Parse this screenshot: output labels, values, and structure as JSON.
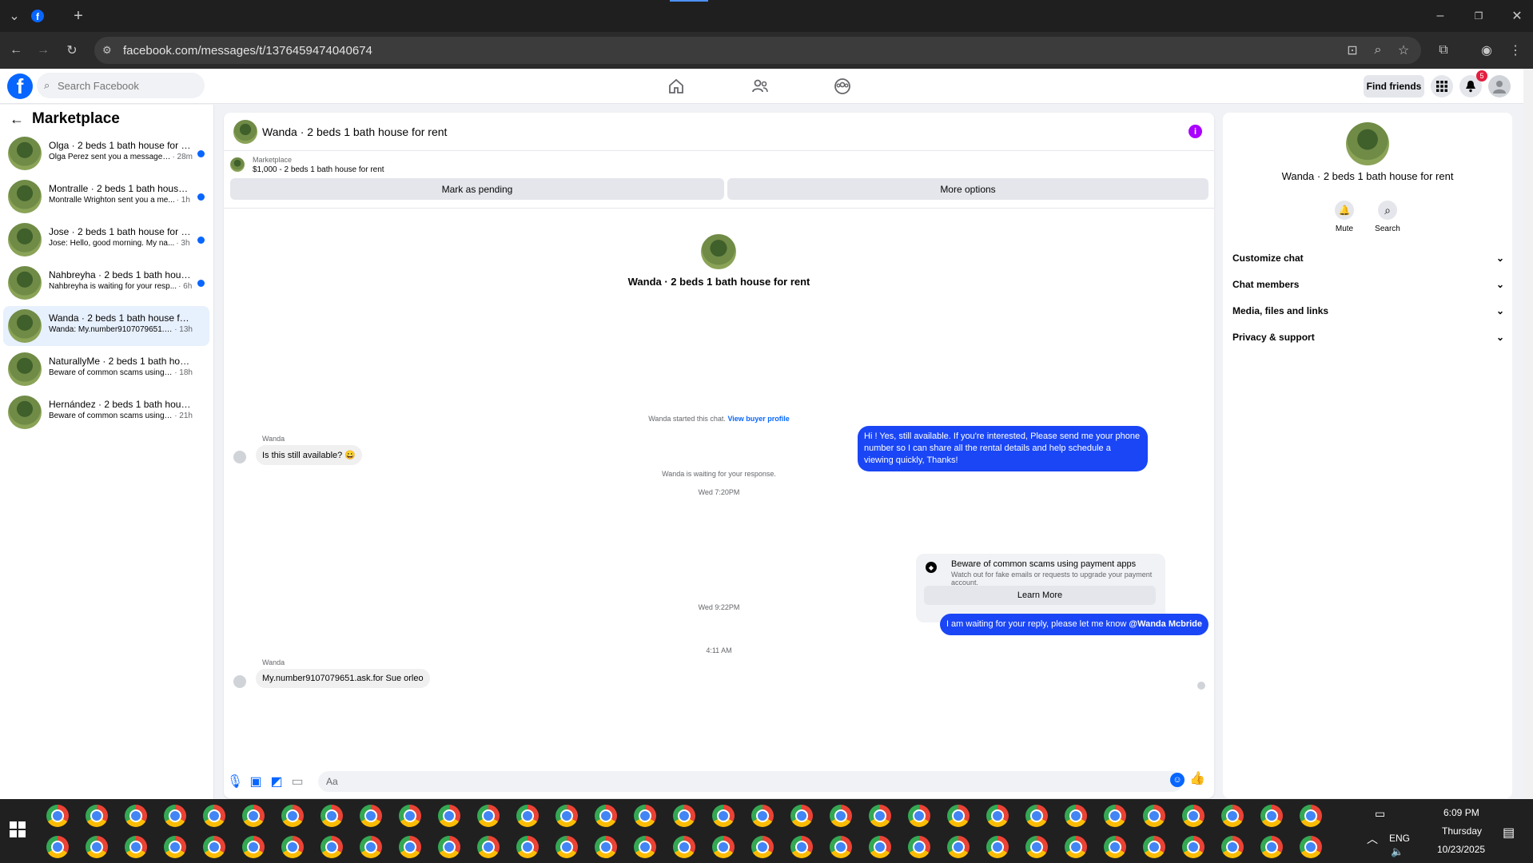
{
  "browser": {
    "url": "facebook.com/messages/t/1376459474040674",
    "tab_icon": "facebook-icon"
  },
  "header": {
    "search_placeholder": "Search Facebook",
    "find_friends": "Find friends",
    "notif_count": "5"
  },
  "sidebar": {
    "title": "Marketplace",
    "conversations": [
      {
        "title": "Olga · 2 beds 1 bath house for rent",
        "preview": "Olga Perez sent you a message a...",
        "time": "· 28m",
        "unread": true
      },
      {
        "title": "Montralle · 2 beds 1 bath house f...",
        "preview": "Montralle Wrighton sent you a me...",
        "time": "· 1h",
        "unread": true
      },
      {
        "title": "Jose · 2 beds 1 bath house for rent",
        "preview": "Jose: Hello, good morning. My na...",
        "time": "· 3h",
        "unread": true
      },
      {
        "title": "Nahbreyha · 2 beds 1 bath house...",
        "preview": "Nahbreyha is waiting for your resp...",
        "time": "· 6h",
        "unread": true
      },
      {
        "title": "Wanda · 2 beds 1 bath house for re...",
        "preview": "Wanda: My.number9107079651.ask.f...",
        "time": "· 13h",
        "unread": false
      },
      {
        "title": "NaturallyMe · 2 beds 1 bath house ...",
        "preview": "Beware of common scams using pay...",
        "time": "· 18h",
        "unread": false
      },
      {
        "title": "Hernández · 2 beds 1 bath hous...",
        "preview": "Beware of common scams using ...",
        "time": "· 21h",
        "unread": false
      }
    ]
  },
  "chat": {
    "title": "Wanda · 2 beds 1 bath house for rent",
    "marketplace_label": "Marketplace",
    "listing": "$1,000 - 2 beds 1 bath house for rent",
    "mark_pending": "Mark as pending",
    "more_options": "More options",
    "profile_name": "Wanda · 2 beds 1 bath house for rent",
    "started_text": "Wanda started this chat.",
    "view_buyer_profile": "View buyer profile",
    "sender1": "Wanda",
    "msg1": "Is this still available? 😀",
    "waiting_text": "Wanda is waiting for your response.",
    "ts1": "Wed 7:20PM",
    "out1": "Hi ! Yes, still available. If you're interested, Please send me your phone number so I can share all the rental details and help schedule a viewing quickly, Thanks!",
    "scam_title": "Beware of common scams using payment apps",
    "scam_body": "Watch out for fake emails or requests to upgrade your payment account.",
    "learn_more": "Learn More",
    "ts2": "Wed 9:22PM",
    "out2_text": "I am waiting for your reply, please let me know ",
    "out2_mention": "@Wanda Mcbride",
    "ts3": "4:11 AM",
    "sender2": "Wanda",
    "msg2": "My.number9107079651.ask.for Sue orleo",
    "composer_placeholder": "Aa"
  },
  "right_panel": {
    "name": "Wanda · 2 beds 1 bath house for rent",
    "mute": "Mute",
    "search": "Search",
    "sections": [
      "Customize chat",
      "Chat members",
      "Media, files and links",
      "Privacy & support"
    ]
  },
  "taskbar": {
    "time": "6:09 PM",
    "day": "Thursday",
    "date": "10/23/2025",
    "lang": "ENG"
  },
  "colors": {
    "brand": "#0866ff",
    "outgoing_bubble": "#1a46f5",
    "info_icon": "#aa00ff"
  }
}
